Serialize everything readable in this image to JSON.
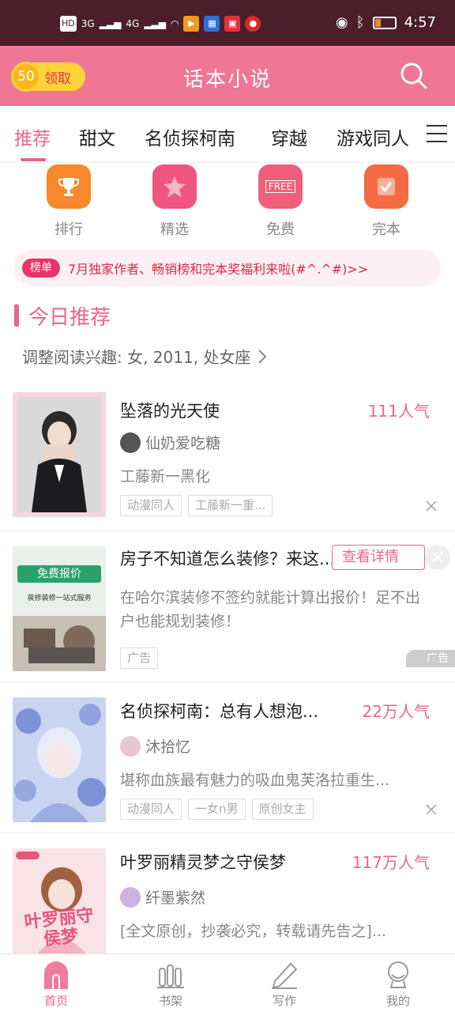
{
  "status_bar": {
    "network": "HD",
    "signal1": "3G",
    "signal2": "4G",
    "time": "4:57"
  },
  "header": {
    "coin_value": "50",
    "coin_label": "领取",
    "title": "话本小说"
  },
  "tabs": [
    {
      "label": "推荐",
      "active": true
    },
    {
      "label": "甜文"
    },
    {
      "label": "名侦探柯南"
    },
    {
      "label": "穿越"
    },
    {
      "label": "游戏同人"
    }
  ],
  "quick_links": [
    {
      "label": "排行",
      "icon": "trophy-icon",
      "color": "#f7882b"
    },
    {
      "label": "精选",
      "icon": "star-icon",
      "color": "#f0557f"
    },
    {
      "label": "免费",
      "icon": "free-icon",
      "color": "#f15f7d",
      "icon_text": "FREE"
    },
    {
      "label": "完本",
      "icon": "check-icon",
      "color": "#f46b43"
    }
  ],
  "notice": {
    "badge": "榜单",
    "text": "7月独家作者、畅销榜和完本奖福利来啦(#^.^#)>>"
  },
  "section": {
    "title": "今日推荐",
    "preference": "调整阅读兴趣: 女, 2011, 处女座"
  },
  "cards": [
    {
      "title": "坠落的光天使",
      "popularity": "111人气",
      "author": "仙奶爱吃糖",
      "desc": "工藤新一黑化",
      "tags": [
        "动漫同人",
        "工藤新一重..."
      ]
    },
    {
      "title": "房子不知道怎么装修？来这...",
      "detail_label": "查看详情",
      "desc": "在哈尔滨装修不签约就能计算出报价！足不出户也能规划装修！",
      "tags": [
        "广告"
      ],
      "ad_mark": "广告",
      "cover_headline": "免费报价",
      "cover_sub": "装修装修一站式服务"
    },
    {
      "title": "名侦探柯南：总有人想泡...",
      "popularity": "22万人气",
      "author": "沐拾忆",
      "desc": "堪称血族最有魅力的吸血鬼芙洛拉重生...",
      "tags": [
        "动漫同人",
        "一女n男",
        "原创女主"
      ]
    },
    {
      "title": "叶罗丽精灵梦之守侯梦",
      "popularity": "117万人气",
      "author": "纤墨紫然",
      "desc": "[全文原创，抄袭必究，转载请先告之]...",
      "cover_text": "叶罗丽守侯梦"
    }
  ],
  "bottom_nav": [
    {
      "label": "首页",
      "icon": "home-icon",
      "active": true
    },
    {
      "label": "书架",
      "icon": "bookshelf-icon"
    },
    {
      "label": "写作",
      "icon": "pen-icon"
    },
    {
      "label": "我的",
      "icon": "profile-icon"
    }
  ]
}
